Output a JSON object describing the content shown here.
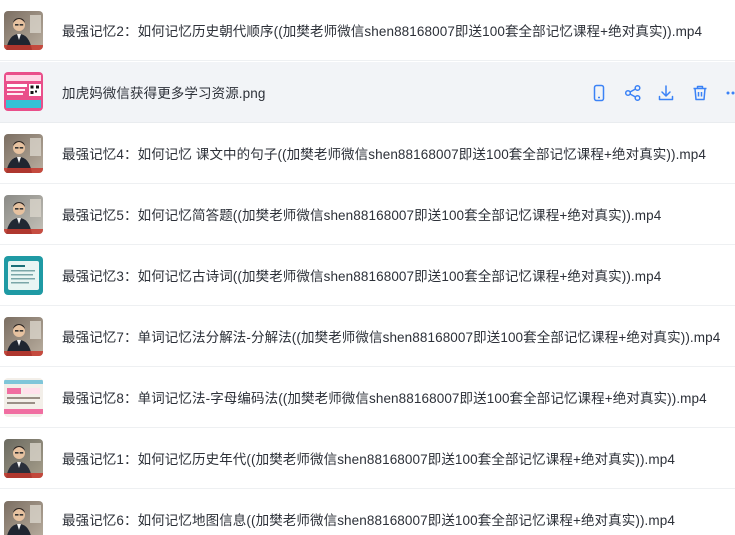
{
  "files": [
    {
      "name": "最强记忆2：如何记忆历史朝代顺序((加樊老师微信shen88168007即送100套全部记忆课程+绝对真实)).mp4",
      "thumb": "teacher-a"
    },
    {
      "name": "加虎妈微信获得更多学习资源.png",
      "thumb": "promo",
      "hovered": true
    },
    {
      "name": "最强记忆4：如何记忆 课文中的句子((加樊老师微信shen88168007即送100套全部记忆课程+绝对真实)).mp4",
      "thumb": "teacher-a"
    },
    {
      "name": "最强记忆5：如何记忆简答题((加樊老师微信shen88168007即送100套全部记忆课程+绝对真实)).mp4",
      "thumb": "teacher-b"
    },
    {
      "name": "最强记忆3：如何记忆古诗词((加樊老师微信shen88168007即送100套全部记忆课程+绝对真实)).mp4",
      "thumb": "slide-teal"
    },
    {
      "name": "最强记忆7：单词记忆法分解法-分解法((加樊老师微信shen88168007即送100套全部记忆课程+绝对真实)).mp4",
      "thumb": "teacher-a"
    },
    {
      "name": "最强记忆8：单词记忆法-字母编码法((加樊老师微信shen88168007即送100套全部记忆课程+绝对真实)).mp4",
      "thumb": "slide-pink"
    },
    {
      "name": "最强记忆1：如何记忆历史年代((加樊老师微信shen88168007即送100套全部记忆课程+绝对真实)).mp4",
      "thumb": "teacher-c"
    },
    {
      "name": "最强记忆6：如何记忆地图信息((加樊老师微信shen88168007即送100套全部记忆课程+绝对真实)).mp4",
      "thumb": "teacher-a"
    }
  ],
  "actions": [
    {
      "icon": "phone-icon",
      "label": "send-to-phone"
    },
    {
      "icon": "share-icon",
      "label": "share"
    },
    {
      "icon": "download-icon",
      "label": "download"
    },
    {
      "icon": "trash-icon",
      "label": "delete"
    },
    {
      "icon": "more-icon",
      "label": "more"
    }
  ],
  "colors": {
    "accent": "#3b82f6",
    "text": "#2c3038",
    "hover_bg": "#f2f4f7"
  }
}
